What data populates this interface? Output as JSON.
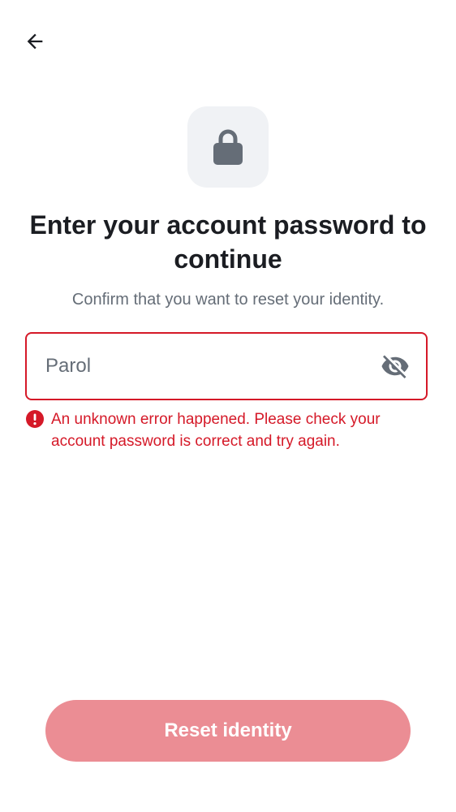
{
  "header": {
    "back_icon": "arrow-left-icon"
  },
  "hero": {
    "icon": "lock-icon",
    "title": "Enter your account password to continue",
    "subtitle": "Confirm that you want to reset your identity."
  },
  "password_field": {
    "value": "",
    "placeholder": "Parol",
    "visibility_icon": "eye-off-icon"
  },
  "error": {
    "icon": "error-circle-icon",
    "message": "An unknown error happened. Please check your account password is correct and try again."
  },
  "actions": {
    "reset_label": "Reset identity"
  },
  "colors": {
    "error": "#d51928",
    "button_disabled": "#eb8d94",
    "icon_tile": "#f0f2f5",
    "icon_gray": "#656d77",
    "text_primary": "#1b1d22"
  }
}
